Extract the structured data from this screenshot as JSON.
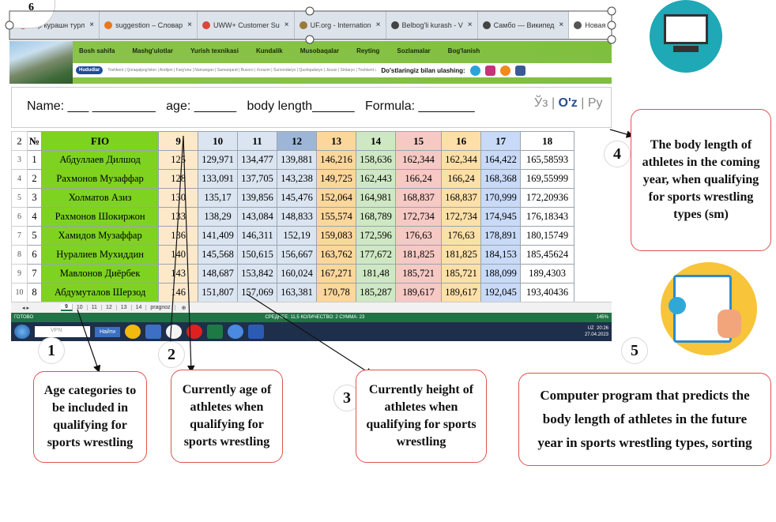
{
  "browser": {
    "tabs": [
      {
        "label": "..ор курашн турл",
        "color": "#d9473b"
      },
      {
        "label": "suggestion – Словар",
        "color": "#e8771e"
      },
      {
        "label": "UWW+ Customer Su",
        "color": "#d9473b"
      },
      {
        "label": "UF.org - Internation",
        "color": "#9a7a3a"
      },
      {
        "label": "Belbog'li kurash - V",
        "color": "#444444"
      },
      {
        "label": "Самбо — Википед",
        "color": "#444444"
      },
      {
        "label": "Новая вкладка",
        "color": "#555555",
        "active": true
      }
    ],
    "corner_badge": "6"
  },
  "site": {
    "nav": [
      "Bosh sahifa",
      "Mashg'ulotlar",
      "Yurish texnikasi",
      "Kundalik",
      "Musobaqalar",
      "Reyting",
      "Sozlamalar",
      "Bog'lanish"
    ],
    "logo": "Hududlar",
    "regions": "Toshkent | Qoraqalpog'iston | Andijon | Farg'ona | Namangan | Samarqand | Buxoro | Xorazm | Surxondaryo | Qashqadaryo | Jizzax | Sirdaryo | Toshkent vil. | Navoiy",
    "follow": "Do'stlaringiz bilan ulashing:"
  },
  "form": {
    "name": "Name: ___ _________",
    "age": "age: ______",
    "body": "body length______",
    "formula": "Formula: ________",
    "langs": [
      "Ўз",
      "O'z",
      "Ру"
    ]
  },
  "table": {
    "row_numbers": [
      "2",
      "3",
      "4",
      "5",
      "6",
      "7",
      "8",
      "9",
      "10"
    ],
    "headers": [
      "№",
      "FIO",
      "9",
      "10",
      "11",
      "12",
      "13",
      "14",
      "15",
      "16",
      "17",
      "18"
    ],
    "rows": [
      [
        "1",
        "Абдуллаев Дилшод",
        "125",
        "129,971",
        "134,477",
        "139,881",
        "146,216",
        "158,636",
        "162,344",
        "162,344",
        "164,422",
        "165,58593"
      ],
      [
        "2",
        "Рахмонов Музаффар",
        "128",
        "133,091",
        "137,705",
        "143,238",
        "149,725",
        "162,443",
        "166,24",
        "166,24",
        "168,368",
        "169,55999"
      ],
      [
        "3",
        "Холматов Азиз",
        "130",
        "135,17",
        "139,856",
        "145,476",
        "152,064",
        "164,981",
        "168,837",
        "168,837",
        "170,999",
        "172,20936"
      ],
      [
        "4",
        "Рахмонов Шокиржон",
        "133",
        "138,29",
        "143,084",
        "148,833",
        "155,574",
        "168,789",
        "172,734",
        "172,734",
        "174,945",
        "176,18343"
      ],
      [
        "5",
        "Хамидов Музаффар",
        "136",
        "141,409",
        "146,311",
        "152,19",
        "159,083",
        "172,596",
        "176,63",
        "176,63",
        "178,891",
        "180,15749"
      ],
      [
        "6",
        "Нуралиев Мухиддин",
        "140",
        "145,568",
        "150,615",
        "156,667",
        "163,762",
        "177,672",
        "181,825",
        "181,825",
        "184,153",
        "185,45624"
      ],
      [
        "7",
        "Мавлонов Диёрбек",
        "143",
        "148,687",
        "153,842",
        "160,024",
        "167,271",
        "181,48",
        "185,721",
        "185,721",
        "188,099",
        "189,4303"
      ],
      [
        "8",
        "Абдумуталов Шерзод",
        "146",
        "151,807",
        "157,069",
        "163,381",
        "170,78",
        "185,287",
        "189,617",
        "189,617",
        "192,045",
        "193,40436"
      ]
    ]
  },
  "sheets": [
    "9",
    "10",
    "11",
    "12",
    "13",
    "14",
    "pragnoz"
  ],
  "status": {
    "left": "ГОТОВО",
    "middle": "СРЕДНЕЕ: 11,5   КОЛИЧЕСТВО: 2   СУММА: 23",
    "zoom": "145%"
  },
  "taskbar": {
    "search": "VPN",
    "search_btn": "Найти",
    "time": "20:26",
    "date": "27.04.2023",
    "lang": "UZ"
  },
  "annotations": {
    "n1": "1",
    "n2": "2",
    "n3": "3",
    "n4": "4",
    "n5": "5",
    "a1": "Age categories to be included in qualifying for sports wrestling",
    "a2": "Currently age of athletes when qualifying for sports wrestling",
    "a3": "Currently height of athletes when qualifying for sports wrestling",
    "a4": "The body length of athletes in the coming year, when qualifying for sports wrestling types (sm)",
    "a5": "Computer program that predicts the body length of athletes in the future year in sports wrestling types, sorting"
  }
}
